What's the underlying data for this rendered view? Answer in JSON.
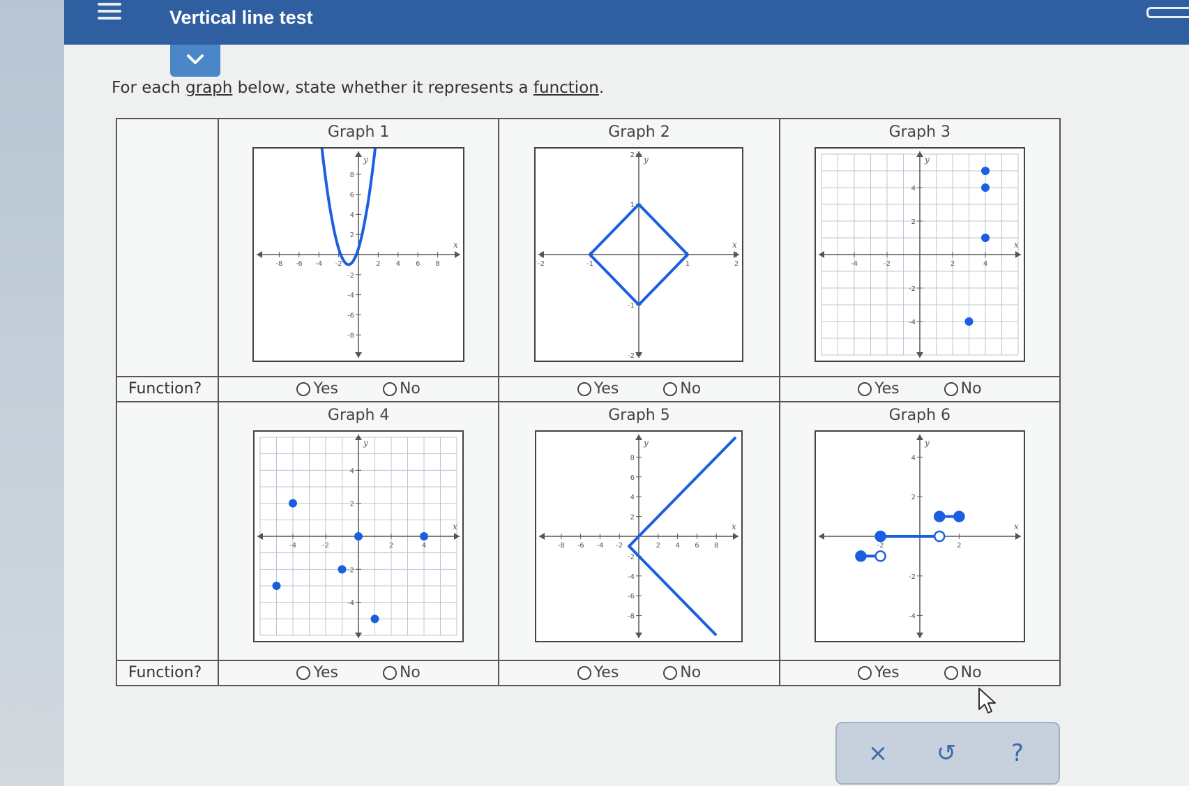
{
  "header": {
    "title": "Vertical line test"
  },
  "instruction": {
    "pre": "For each ",
    "link1": "graph",
    "mid": " below, state whether it represents a ",
    "link2": "function",
    "post": "."
  },
  "function_label": "Function?",
  "options": {
    "yes": "Yes",
    "no": "No"
  },
  "graphs": [
    {
      "title": "Graph 1"
    },
    {
      "title": "Graph 2"
    },
    {
      "title": "Graph 3"
    },
    {
      "title": "Graph 4"
    },
    {
      "title": "Graph 5"
    },
    {
      "title": "Graph 6"
    }
  ],
  "actions": {
    "close": "×",
    "undo": "↺",
    "help": "?"
  },
  "colors": {
    "accent": "#2f5fa0",
    "curve": "#1a5fe0"
  },
  "chart_data": [
    {
      "type": "line",
      "title": "Graph 1",
      "xlabel": "x",
      "ylabel": "y",
      "xlim": [
        -10,
        10
      ],
      "ylim": [
        -10,
        10
      ],
      "xticks": [
        -8,
        -6,
        -4,
        -2,
        2,
        4,
        6,
        8
      ],
      "yticks": [
        -8,
        -6,
        -4,
        -2,
        2,
        4,
        6,
        8
      ],
      "curve": "parabola",
      "vertex": [
        -1,
        -1
      ],
      "x_range": [
        -4.4,
        2.4
      ],
      "grid": false
    },
    {
      "type": "line",
      "title": "Graph 2",
      "xlabel": "x",
      "ylabel": "y",
      "xlim": [
        -2,
        2
      ],
      "ylim": [
        -2,
        2
      ],
      "xticks": [
        -2,
        -1,
        1,
        2
      ],
      "yticks": [
        -2,
        -1,
        1,
        2
      ],
      "points": [
        [
          0,
          1
        ],
        [
          1,
          0
        ],
        [
          0,
          -1
        ],
        [
          -1,
          0
        ]
      ],
      "closed": true,
      "grid": false
    },
    {
      "type": "scatter",
      "title": "Graph 3",
      "xlabel": "x",
      "ylabel": "y",
      "xlim": [
        -6,
        6
      ],
      "ylim": [
        -6,
        6
      ],
      "xticks": [
        -4,
        -2,
        2,
        4
      ],
      "yticks": [
        -4,
        -2,
        2,
        4
      ],
      "points": [
        [
          4,
          5
        ],
        [
          4,
          4
        ],
        [
          4,
          1
        ],
        [
          3,
          -4
        ]
      ],
      "grid": true
    },
    {
      "type": "scatter",
      "title": "Graph 4",
      "xlabel": "x",
      "ylabel": "y",
      "xlim": [
        -6,
        6
      ],
      "ylim": [
        -6,
        6
      ],
      "xticks": [
        -4,
        -2,
        2,
        4
      ],
      "yticks": [
        -4,
        -2,
        2,
        4
      ],
      "points": [
        [
          -4,
          2
        ],
        [
          -5,
          -3
        ],
        [
          0,
          0
        ],
        [
          4,
          0
        ],
        [
          -1,
          -2
        ],
        [
          1,
          -5
        ]
      ],
      "grid": true
    },
    {
      "type": "line",
      "title": "Graph 5",
      "xlabel": "x",
      "ylabel": "y",
      "xlim": [
        -10,
        10
      ],
      "ylim": [
        -10,
        10
      ],
      "xticks": [
        -8,
        -6,
        -4,
        -2,
        2,
        4,
        6,
        8
      ],
      "yticks": [
        -8,
        -6,
        -4,
        -2,
        2,
        4,
        6,
        8
      ],
      "points": [
        [
          10,
          10
        ],
        [
          0,
          0
        ],
        [
          -1,
          -1
        ],
        [
          0,
          -2
        ],
        [
          8,
          -10
        ]
      ],
      "grid": false
    },
    {
      "type": "line",
      "title": "Graph 6",
      "xlabel": "x",
      "ylabel": "y",
      "xlim": [
        -5,
        5
      ],
      "ylim": [
        -5,
        5
      ],
      "xticks": [
        -2,
        2
      ],
      "yticks": [
        -4,
        -2,
        2,
        4
      ],
      "segments": [
        {
          "from": [
            -3,
            -1
          ],
          "to": [
            -2,
            -1
          ],
          "from_closed": true,
          "to_closed": false
        },
        {
          "from": [
            -2,
            0
          ],
          "to": [
            1,
            0
          ],
          "from_closed": true,
          "to_closed": false
        },
        {
          "from": [
            1,
            1
          ],
          "to": [
            2,
            1
          ],
          "from_closed": true,
          "to_closed": true
        }
      ],
      "grid": false
    }
  ]
}
